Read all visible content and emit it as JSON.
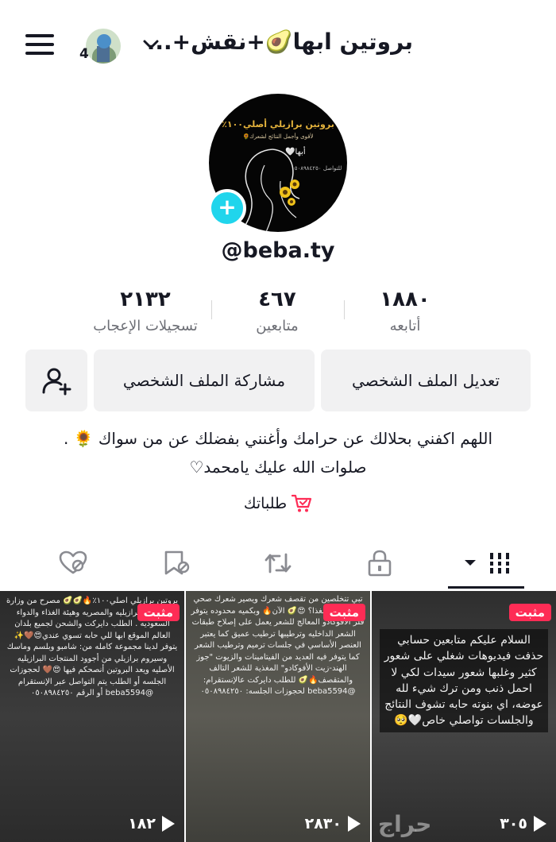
{
  "header": {
    "account_name": "بروتين ابها🥑+نقش+...",
    "notification_count": "4"
  },
  "avatar": {
    "line1": "بروتين برازيلي أصلي١٠٠٪",
    "line2": "لأقوى وأجمل النتائج لشعرك🌻",
    "line3": "أبها🤍",
    "line4": "للتواصل ٠٥٠٨٩٨٤٢٥٠"
  },
  "profile": {
    "username": "@beba.ty"
  },
  "stats": [
    {
      "value": "١٨٨٠",
      "label": "أتابعه"
    },
    {
      "value": "٤٦٧",
      "label": "متابعين"
    },
    {
      "value": "٢١٣٢",
      "label": "تسجيلات الإعجاب"
    }
  ],
  "buttons": {
    "edit_profile": "تعديل الملف الشخصي",
    "share_profile": "مشاركة الملف الشخصي"
  },
  "bio": {
    "line1": "اللهم اكفني بحلالك عن حرامك وأغنني بفضلك عن من سواك 🌻 .",
    "line2": "صلوات الله عليك يامحمد♡"
  },
  "orders_label": "طلباتك",
  "tabs": [
    "videos",
    "private",
    "reposts",
    "favorites",
    "liked"
  ],
  "videos": [
    {
      "pinned_label": "مثبت",
      "text": "بروتين برازيلي اصلي١٠٠٪🔥🥑🥑 مصرح من وزارة الصحه البرازيليه والمصريه وهيئة الغذاء والدواء السعوديه . الطلب دايركت والشحن لجميع بلدان العالم الموقع ابها للي حابه تسوي عندي😍🤎✨ يتوفر لدينا مجموعة كامله من: شامبو وبلسم وماسك وسيروم برازيلي من أجوود المنتجات البرازيليه الأصليه ويعد البروتين أنصحكم فيها 😍🤎 لحجوزات الجلسه أو الطلب يتم التواصل عبر الإنستقرام @beba5594 أو الرقم ٠٥٠٨٩٨٤٢٥٠",
      "views": "١٨٢"
    },
    {
      "pinned_label": "مثبت",
      "text": "تبي تتخلصين من تقصف شعرك ويصير شعرك صحي وفيه لمعه ومغذا؟ 😍🥑 الآن🔥 وبكميه محدوده يتوفر فلر الأفوكادو المعالج للشعر يعمل على إصلاح طبقات الشعر الداخليه وترطيبها ترطيب عميق كما يعتبر العنصر الأساسي في جلسات ترميم وترطيب الشعر كما يتوفر فيه العديد من الفيتامينات والزيوت \"جوز الهند-زيت الأفوكادو\" المغذية للشعر التالف والمتقصف🔥🥑 للطلب دايركت عالإنستقرام: @beba5594 لحجوزات الجلسه: ٠٥٠٨٩٨٤٢٥٠",
      "views": "٢٨٣٠"
    },
    {
      "pinned_label": "مثبت",
      "text": "السلام عليكم متابعين حسابي حذفت فيديوهات شغلي على شعور كثير وغلبها شعور سيدات لكي لا احمل ذنب ومن ترك شيء لله عوضه، اي بنوته حابه تشوف النتائج والجلسات تواصلي خاص🤍🥺",
      "views": "٣٠٥"
    }
  ],
  "watermark": "حراج"
}
